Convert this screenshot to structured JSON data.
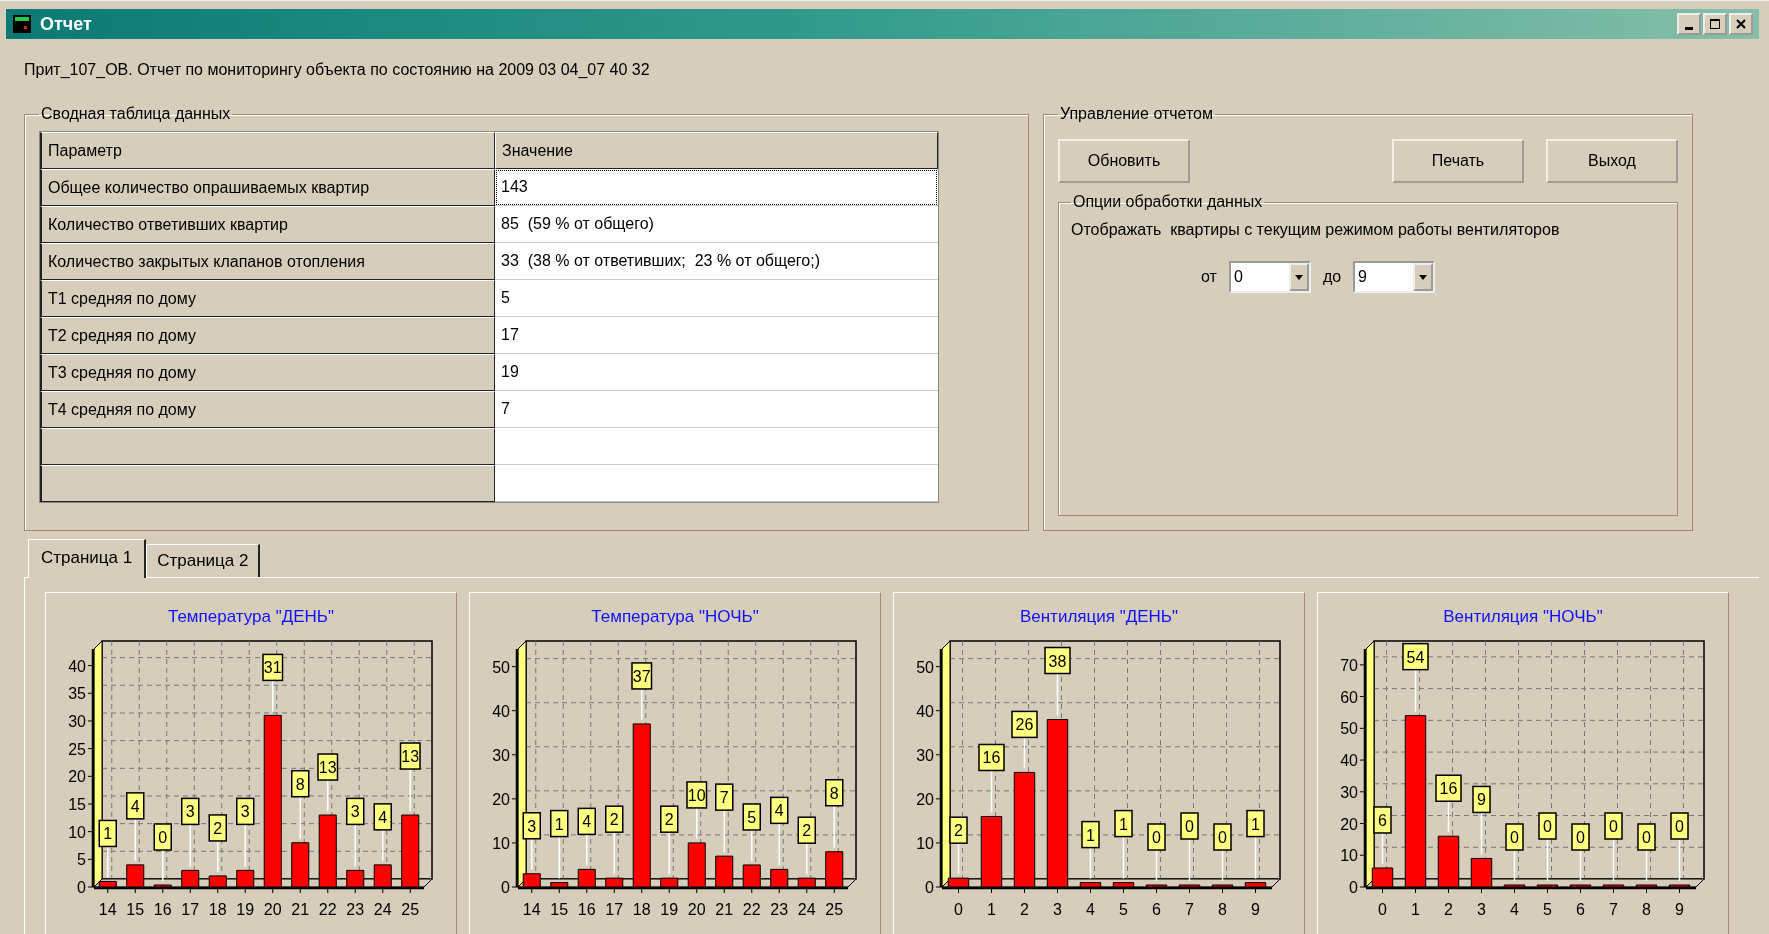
{
  "window": {
    "title": "Отчет"
  },
  "header": "Прит_107_ОВ. Отчет по мониторингу объекта по состоянию на 2009 03 04_07 40 32",
  "summary": {
    "title": "Сводная таблица данных",
    "columns": [
      "Параметр",
      "Значение"
    ],
    "rows": [
      {
        "parameter": "Общее количество опрашиваемых квартир",
        "value": "143",
        "focused": true
      },
      {
        "parameter": "Количество ответивших квартир",
        "value": "85  (59 % от общего)",
        "focused": false
      },
      {
        "parameter": "Количество закрытых клапанов отопления",
        "value": "33  (38 % от ответивших;  23 % от общего;)",
        "focused": false
      },
      {
        "parameter": "Т1 средняя по дому",
        "value": "5",
        "focused": false
      },
      {
        "parameter": "Т2 средняя по дому",
        "value": "17",
        "focused": false
      },
      {
        "parameter": "Т3 средняя по дому",
        "value": "19",
        "focused": false
      },
      {
        "parameter": "Т4 средняя по дому",
        "value": "7",
        "focused": false
      }
    ]
  },
  "control": {
    "title": "Управление отчетом",
    "buttons": [
      "Обновить",
      "Печать",
      "Выход"
    ],
    "options": {
      "title": "Опции обработки данных",
      "text": "Отображать  квартиры с текущим режимом работы вентиляторов",
      "from_label": "от",
      "from_value": "0",
      "to_label": "до",
      "to_value": "9"
    }
  },
  "tabs": [
    {
      "label": "Страница 1",
      "selected": true
    },
    {
      "label": "Страница 2",
      "selected": false
    }
  ],
  "charts": [
    {
      "chart_data": {
        "type": "bar",
        "title": "Температура  \"ДЕНЬ\"",
        "categories": [
          "14",
          "15",
          "16",
          "17",
          "18",
          "19",
          "20",
          "21",
          "22",
          "23",
          "24",
          "25"
        ],
        "values": [
          1,
          4,
          0,
          3,
          2,
          3,
          31,
          8,
          13,
          3,
          4,
          13
        ],
        "ylim": [
          0,
          43
        ],
        "yticks": [
          0,
          5,
          10,
          15,
          20,
          25,
          30,
          35,
          40
        ],
        "data_labels": true
      }
    },
    {
      "chart_data": {
        "type": "bar",
        "title": "Температура  \"НОЧЬ\"",
        "categories": [
          "14",
          "15",
          "16",
          "17",
          "18",
          "19",
          "20",
          "21",
          "22",
          "23",
          "24",
          "25"
        ],
        "values": [
          3,
          1,
          4,
          2,
          37,
          2,
          10,
          7,
          5,
          4,
          2,
          8
        ],
        "ylim": [
          0,
          54
        ],
        "yticks": [
          0,
          10,
          20,
          30,
          40,
          50
        ],
        "data_labels": true
      }
    },
    {
      "chart_data": {
        "type": "bar",
        "title": "Вентиляция  \"ДЕНЬ\"",
        "categories": [
          "0",
          "1",
          "2",
          "3",
          "4",
          "5",
          "6",
          "7",
          "8",
          "9"
        ],
        "values": [
          2,
          16,
          26,
          38,
          1,
          1,
          0,
          0,
          0,
          1
        ],
        "ylim": [
          0,
          54
        ],
        "yticks": [
          0,
          10,
          20,
          30,
          40,
          50
        ],
        "data_labels": true
      }
    },
    {
      "chart_data": {
        "type": "bar",
        "title": "Вентиляция  \"НОЧЬ\"",
        "categories": [
          "0",
          "1",
          "2",
          "3",
          "4",
          "5",
          "6",
          "7",
          "8",
          "9"
        ],
        "values": [
          6,
          54,
          16,
          9,
          0,
          0,
          0,
          0,
          0,
          0
        ],
        "ylim": [
          0,
          75
        ],
        "yticks": [
          0,
          10,
          20,
          30,
          40,
          50,
          60,
          70
        ],
        "data_labels": true
      }
    }
  ]
}
